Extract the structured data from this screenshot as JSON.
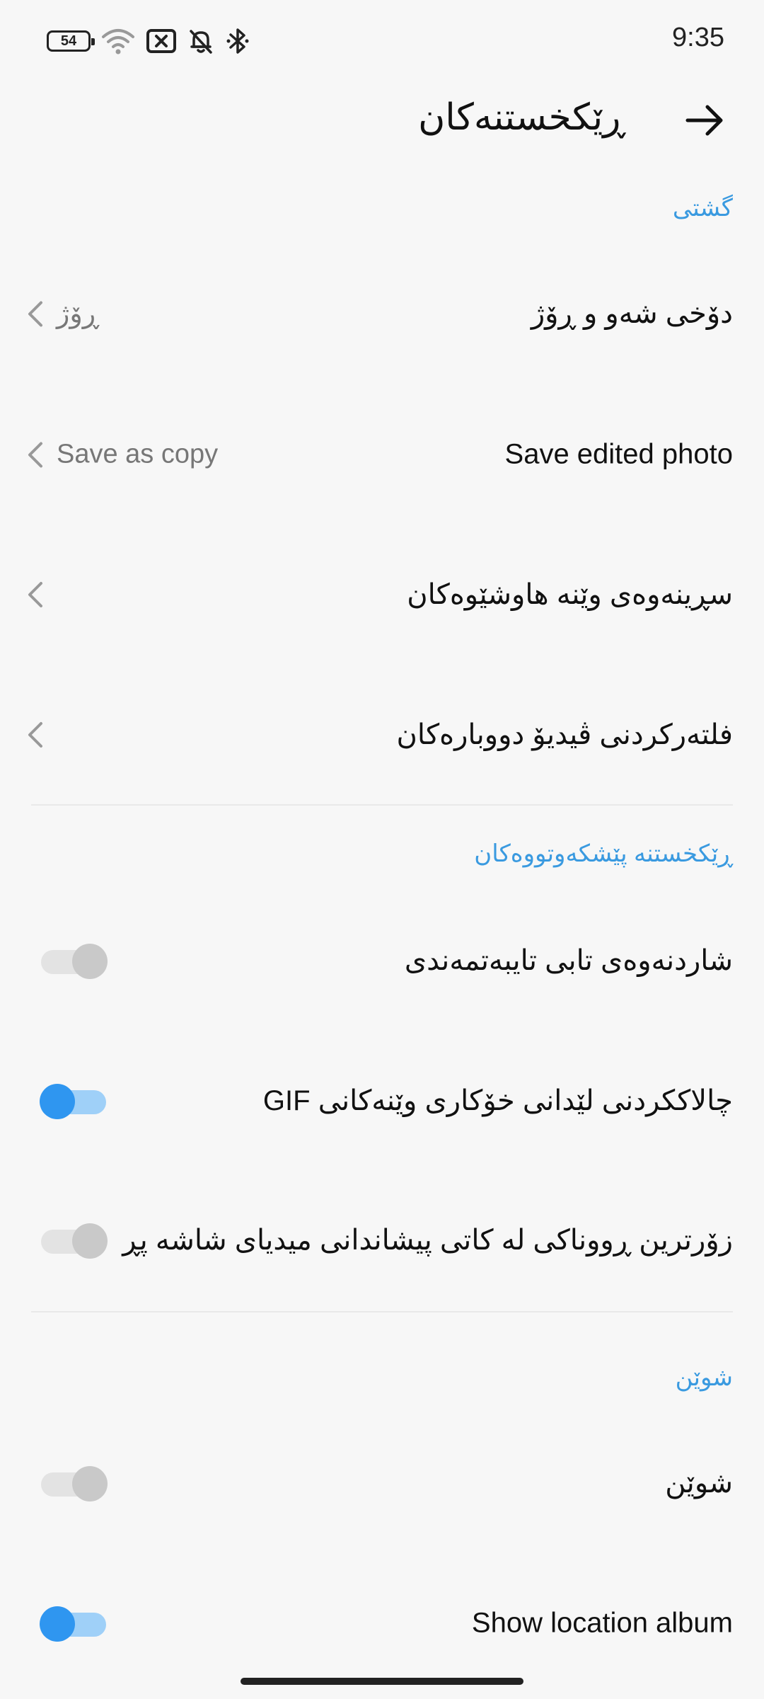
{
  "status_bar": {
    "battery": "54",
    "time": "9:35",
    "icons": [
      "wifi-icon",
      "sim-x-icon",
      "bell-off-icon",
      "bluetooth-icon"
    ]
  },
  "header": {
    "title": "ڕێکخستنەکان",
    "back_icon": "arrow-icon"
  },
  "sections": {
    "general": {
      "title": "گشتی",
      "items": [
        {
          "label": "دۆخی شەو و ڕۆژ",
          "value": "ڕۆژ"
        },
        {
          "label": "Save edited photo",
          "value": "Save as copy"
        },
        {
          "label": "سڕینەوەی وێنە هاوشێوەکان",
          "value": ""
        },
        {
          "label": "فلتەرکردنی ڤیدیۆ دووبارەکان",
          "value": ""
        }
      ]
    },
    "advanced": {
      "title": "ڕێکخستنە پێشکەوتووەکان",
      "items": [
        {
          "label": "شاردنەوەی تابی تایبەتمەندی",
          "state": "off"
        },
        {
          "label": "چالاککردنی لێدانی خۆکاری وێنەکانی GIF",
          "state": "on"
        },
        {
          "label": "زۆرترین ڕووناکی لە کاتی پیشاندانی میدیای شاشە پڕ",
          "state": "off"
        }
      ]
    },
    "location": {
      "title": "شوێن",
      "items": [
        {
          "label": "شوێن",
          "state": "off"
        },
        {
          "label": "Show location album",
          "state": "on"
        }
      ]
    }
  },
  "colors": {
    "accent": "#2f96f0",
    "section_header": "#3a9ae0",
    "background": "#f7f7f7"
  }
}
